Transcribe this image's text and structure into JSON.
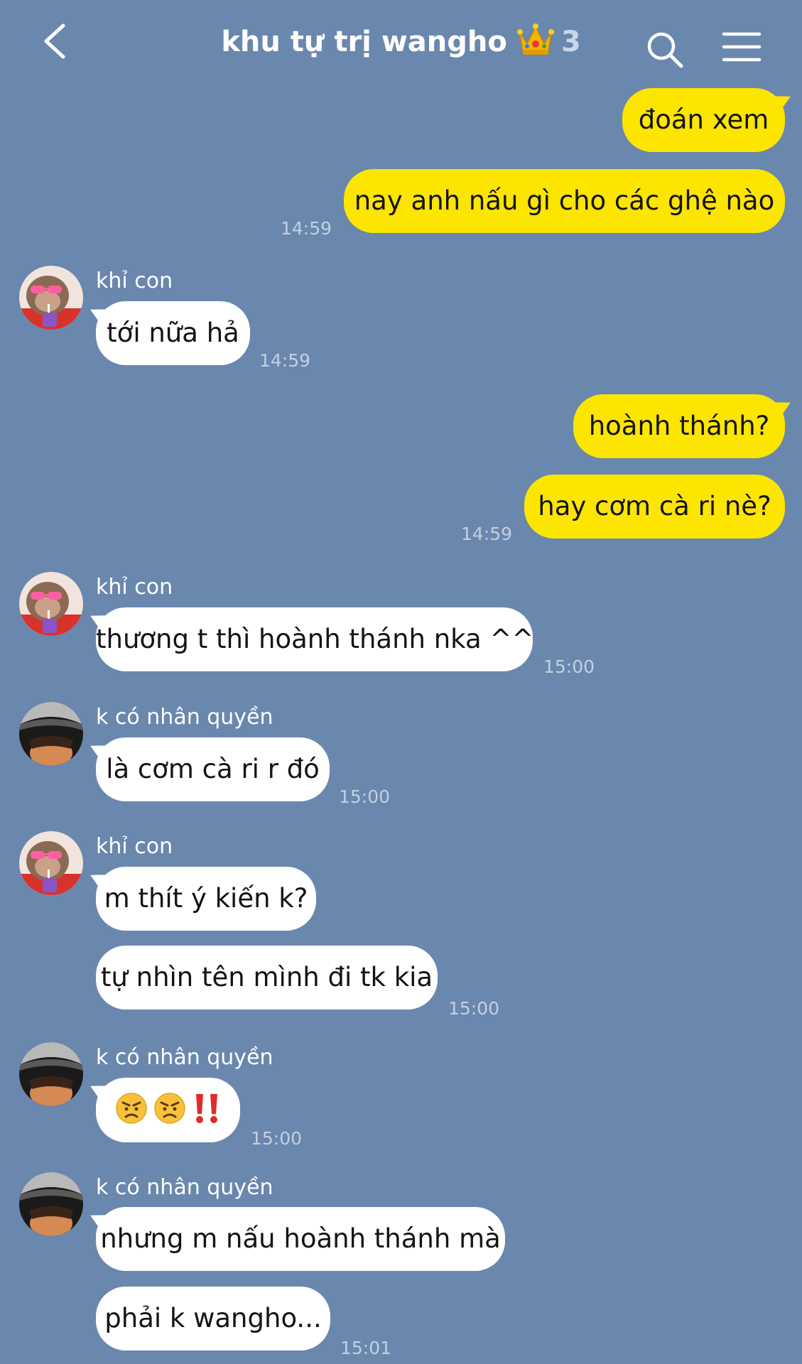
{
  "header": {
    "title": "khu tự trị wangho",
    "member_count": "3",
    "icons": {
      "back": "chevron-left-icon",
      "title_emoji": "crown-icon",
      "search": "search-icon",
      "menu": "hamburger-menu-icon"
    }
  },
  "colors": {
    "background": "#6a87ae",
    "outgoing_bubble": "#fbe501",
    "incoming_bubble": "#ffffff",
    "timestamp": "#c3d0e3"
  },
  "messages": [
    {
      "direction": "out",
      "text": "đoán xem"
    },
    {
      "direction": "out",
      "text": "nay anh nấu gì cho các ghệ nào",
      "time": "14:59"
    },
    {
      "direction": "in",
      "sender": "khỉ con",
      "text": "tới nữa hả",
      "time": "14:59"
    },
    {
      "direction": "out",
      "text": "hoành thánh?"
    },
    {
      "direction": "out",
      "text": "hay cơm cà ri nè?",
      "time": "14:59"
    },
    {
      "direction": "in",
      "sender": "khỉ con",
      "text": "thương t thì hoành thánh nka ^^",
      "time": "15:00"
    },
    {
      "direction": "in",
      "sender": "k có nhân quyền",
      "text": "là cơm cà ri r đó",
      "time": "15:00"
    },
    {
      "direction": "in",
      "sender": "khỉ con",
      "text": "m thít ý kiến k?"
    },
    {
      "direction": "in",
      "text": "tự nhìn tên mình đi tk kia",
      "time": "15:00"
    },
    {
      "direction": "in",
      "sender": "k có nhân quyền",
      "emoji": [
        "angry-face-icon",
        "angry-face-icon",
        "double-exclamation-icon"
      ],
      "time": "15:00"
    },
    {
      "direction": "in",
      "sender": "k có nhân quyền",
      "text": "nhưng m nấu hoành thánh mà"
    },
    {
      "direction": "in",
      "text": "phải k wangho...",
      "time": "15:01"
    }
  ]
}
